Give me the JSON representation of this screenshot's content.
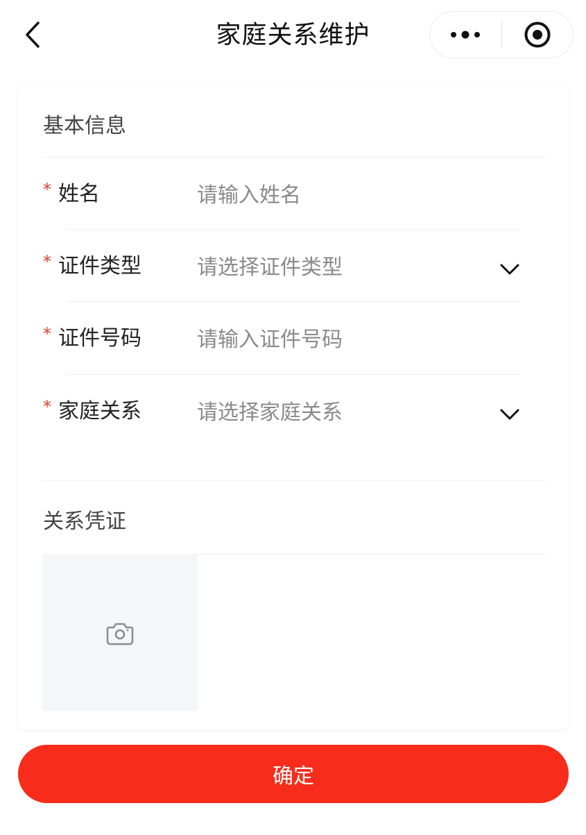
{
  "nav": {
    "title": "家庭关系维护",
    "back_icon": "chevron-left-icon",
    "more_icon": "more-dots-icon",
    "close_icon": "target-circle-icon"
  },
  "form": {
    "basic_section_title": "基本信息",
    "required_mark": "*",
    "name": {
      "label": "姓名",
      "placeholder": "请输入姓名"
    },
    "id_type": {
      "label": "证件类型",
      "placeholder": "请选择证件类型",
      "icon": "chevron-down-icon"
    },
    "id_number": {
      "label": "证件号码",
      "placeholder": "请输入证件号码"
    },
    "relation": {
      "label": "家庭关系",
      "placeholder": "请选择家庭关系",
      "icon": "chevron-down-icon"
    },
    "proof_section_title": "关系凭证",
    "upload_icon": "camera-icon"
  },
  "actions": {
    "confirm_label": "确定"
  },
  "colors": {
    "accent": "#f72c1b",
    "required": "#e8392c",
    "placeholder": "#8a8a8a"
  }
}
